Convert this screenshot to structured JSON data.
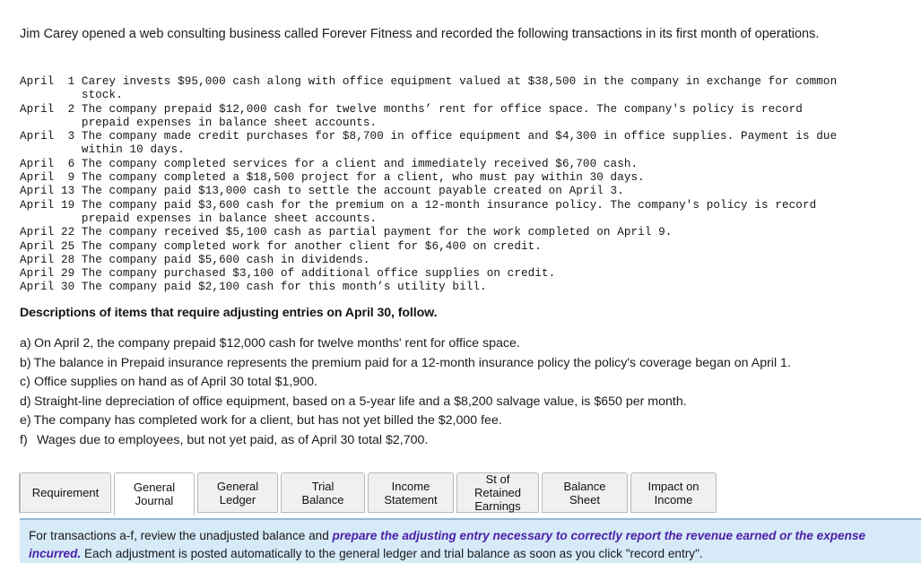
{
  "intro": {
    "text": "Jim Carey opened a web consulting business called Forever Fitness and recorded the following transactions in its first month of operations."
  },
  "transactions": [
    "April  1 Carey invests $95,000 cash along with office equipment valued at $38,500 in the company in exchange for common\n         stock.",
    "April  2 The company prepaid $12,000 cash for twelve months’ rent for office space. The company's policy is record\n         prepaid expenses in balance sheet accounts.",
    "April  3 The company made credit purchases for $8,700 in office equipment and $4,300 in office supplies. Payment is due\n         within 10 days.",
    "April  6 The company completed services for a client and immediately received $6,700 cash.",
    "April  9 The company completed a $18,500 project for a client, who must pay within 30 days.",
    "April 13 The company paid $13,000 cash to settle the account payable created on April 3.",
    "April 19 The company paid $3,600 cash for the premium on a 12-month insurance policy. The company's policy is record\n         prepaid expenses in balance sheet accounts.",
    "April 22 The company received $5,100 cash as partial payment for the work completed on April 9.",
    "April 25 The company completed work for another client for $6,400 on credit.",
    "April 28 The company paid $5,600 cash in dividends.",
    "April 29 The company purchased $3,100 of additional office supplies on credit.",
    "April 30 The company paid $2,100 cash for this month’s utility bill."
  ],
  "descriptions": {
    "heading": "Descriptions of items that require adjusting entries on April 30, follow.",
    "items": [
      {
        "marker": "a)",
        "text": "On April 2, the company prepaid $12,000 cash for twelve months' rent for office space."
      },
      {
        "marker": "b)",
        "text": "The balance in Prepaid insurance represents the premium paid for a 12-month insurance policy the policy's coverage began on April 1."
      },
      {
        "marker": "c)",
        "text": "Office supplies on hand as of April 30 total $1,900."
      },
      {
        "marker": "d)",
        "text": "Straight-line depreciation of office equipment, based on a 5-year life and a $8,200 salvage value, is $650 per month."
      },
      {
        "marker": "e)",
        "text": "The company has completed work for a client, but has not yet billed the $2,000 fee."
      },
      {
        "marker": "f)",
        "text": "Wages due to employees, but not yet paid, as of April 30 total $2,700."
      }
    ]
  },
  "tabs": {
    "active_index": 1,
    "items": [
      {
        "label": "Requirement"
      },
      {
        "label": "General\nJournal"
      },
      {
        "label": "General\nLedger"
      },
      {
        "label": "Trial Balance"
      },
      {
        "label": "Income\nStatement"
      },
      {
        "label": "St of Retained\nEarnings"
      },
      {
        "label": "Balance Sheet"
      },
      {
        "label": "Impact on\nIncome"
      }
    ]
  },
  "instruction_panel": {
    "lead": "For transactions a-f, review the unadjusted balance and ",
    "emphasis": "prepare the adjusting entry necessary to correctly report the revenue earned or the expense incurred.",
    "tail": " Each adjustment is posted automatically to the general ledger and trial balance as soon as you click \"record entry\".",
    "background_color": "#d6eaf8",
    "emphasis_color": "#4b1fa8"
  }
}
